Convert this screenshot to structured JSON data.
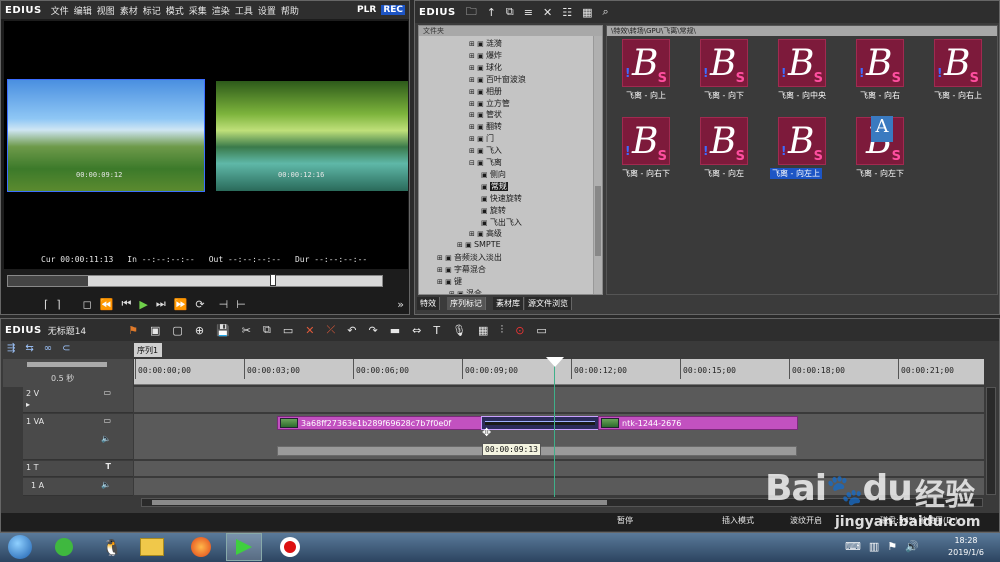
{
  "player": {
    "logo": "EDIUS",
    "menu": [
      "文件",
      "编辑",
      "视图",
      "素材",
      "标记",
      "模式",
      "采集",
      "渲染",
      "工具",
      "设置",
      "帮助"
    ],
    "plr": "PLR",
    "rec": "REC",
    "tc_left": "00:00:09:12",
    "tc_right": "00:00:12:16",
    "cur_label": "Cur",
    "cur_value": "00:00:11:13",
    "in_label": "In",
    "in_value": "--:--:--:--",
    "out_label": "Out",
    "out_value": "--:--:--:--",
    "dur_label": "Dur",
    "dur_value": "--:--:--:--"
  },
  "bin": {
    "logo": "EDIUS",
    "folder_header": "文件夹",
    "path": "\\特效\\转场\\GPU\\飞离\\常规\\",
    "tree": [
      {
        "label": "涟漪",
        "indent": 1
      },
      {
        "label": "爆炸",
        "indent": 1
      },
      {
        "label": "球化",
        "indent": 1
      },
      {
        "label": "百叶窗波浪",
        "indent": 1
      },
      {
        "label": "相册",
        "indent": 1
      },
      {
        "label": "立方管",
        "indent": 1
      },
      {
        "label": "管状",
        "indent": 1
      },
      {
        "label": "翻转",
        "indent": 1
      },
      {
        "label": "门",
        "indent": 1
      },
      {
        "label": "飞入",
        "indent": 1
      },
      {
        "label": "飞离",
        "indent": 1
      },
      {
        "label": "侧向",
        "indent": 2
      },
      {
        "label": "常规",
        "indent": 2
      },
      {
        "label": "快速旋转",
        "indent": 2
      },
      {
        "label": "旋转",
        "indent": 2
      },
      {
        "label": "飞出飞入",
        "indent": 2
      },
      {
        "label": "高级",
        "indent": 1
      },
      {
        "label": "SMPTE",
        "indent": 0
      },
      {
        "label": "音频淡入淡出",
        "indent": -1
      },
      {
        "label": "字幕混合",
        "indent": -1
      },
      {
        "label": "键",
        "indent": -1
      },
      {
        "label": "混合",
        "indent": -2
      }
    ],
    "selected_tree": "常规",
    "items": [
      "飞离 - 向上",
      "飞离 - 向下",
      "飞离 - 向中央",
      "飞离 - 向右",
      "飞离 - 向右上",
      "飞离 - 向右下",
      "飞离 - 向左",
      "飞离 - 向左上",
      "飞离 - 向左下"
    ],
    "selected_item": "飞离 - 向左上",
    "tabs": [
      "特效",
      "序列标记",
      "素材库",
      "源文件浏览"
    ]
  },
  "timeline": {
    "logo": "EDIUS",
    "project": "无标题14",
    "sequence_tab": "序列1",
    "scale": "0.5 秒",
    "ruler": [
      "00:00:00;00",
      "00:00:03;00",
      "00:00:06;00",
      "00:00:09;00",
      "00:00:12;00",
      "00:00:15;00",
      "00:00:18;00",
      "00:00:21;00"
    ],
    "tracks": [
      "2 V",
      "1 VA",
      "1 T",
      "1 A"
    ],
    "clip1_name": "3a68ff27363e1b289f69628c7b7f0e0f",
    "clip2_name": "ntk-1244-2676",
    "tooltip": "00:00:09:13",
    "status": {
      "pause": "暂停",
      "insert": "插入模式",
      "ripple": "波纹开启",
      "disk": "磁盘:54% 被使用(D:)"
    }
  },
  "taskbar": {
    "time": "18:28",
    "date": "2019/1/6"
  },
  "watermark": {
    "brand": "Bai",
    "brand2": "du",
    "jingyan": "经验",
    "url": "jingyan.baidu.com"
  }
}
